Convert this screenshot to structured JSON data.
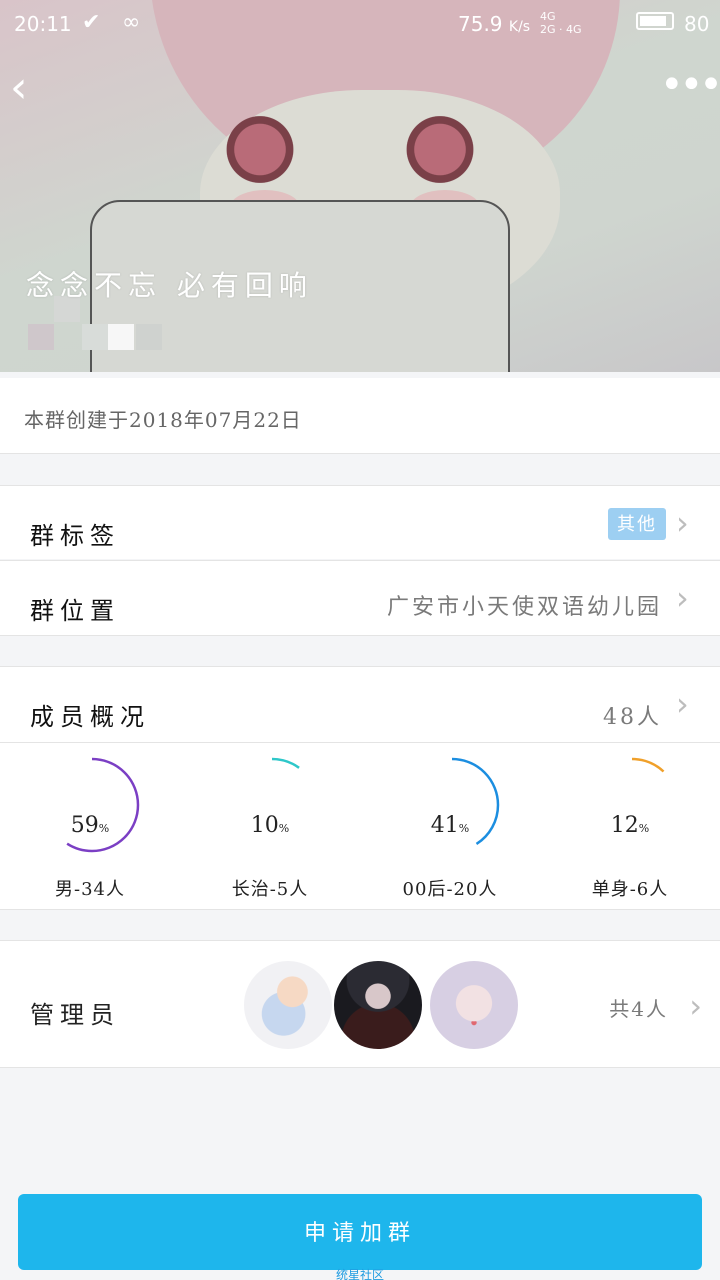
{
  "status_bar": {
    "time": "20:11",
    "speed": "75.9",
    "speed_unit": "K/s",
    "network": "4G",
    "network_sub": "2G · 4G",
    "battery": "80"
  },
  "header": {
    "group_name": "念念不忘 必有回响",
    "back_icon": "chevron-left-icon",
    "more_icon": "more-horizontal-icon"
  },
  "created": {
    "text": "本群创建于2018年07月22日"
  },
  "group_tag": {
    "label": "群标签",
    "value": "其他"
  },
  "group_location": {
    "label": "群位置",
    "value": "广安市小天使双语幼儿园"
  },
  "members": {
    "label": "成员概况",
    "total": "48人",
    "stats": [
      {
        "percent": "59",
        "unit": "%",
        "caption": "男-34人",
        "color": "#7b3fc4",
        "fraction": 0.59
      },
      {
        "percent": "10",
        "unit": "%",
        "caption": "长治-5人",
        "color": "#2ec7c9",
        "fraction": 0.1
      },
      {
        "percent": "41",
        "unit": "%",
        "caption": "00后-20人",
        "color": "#1c8ee0",
        "fraction": 0.41
      },
      {
        "percent": "12",
        "unit": "%",
        "caption": "单身-6人",
        "color": "#f0a02a",
        "fraction": 0.12
      }
    ]
  },
  "admins": {
    "label": "管理员",
    "count": "共4人"
  },
  "apply_button": {
    "label": "申请加群"
  },
  "watermark": "统星社区"
}
